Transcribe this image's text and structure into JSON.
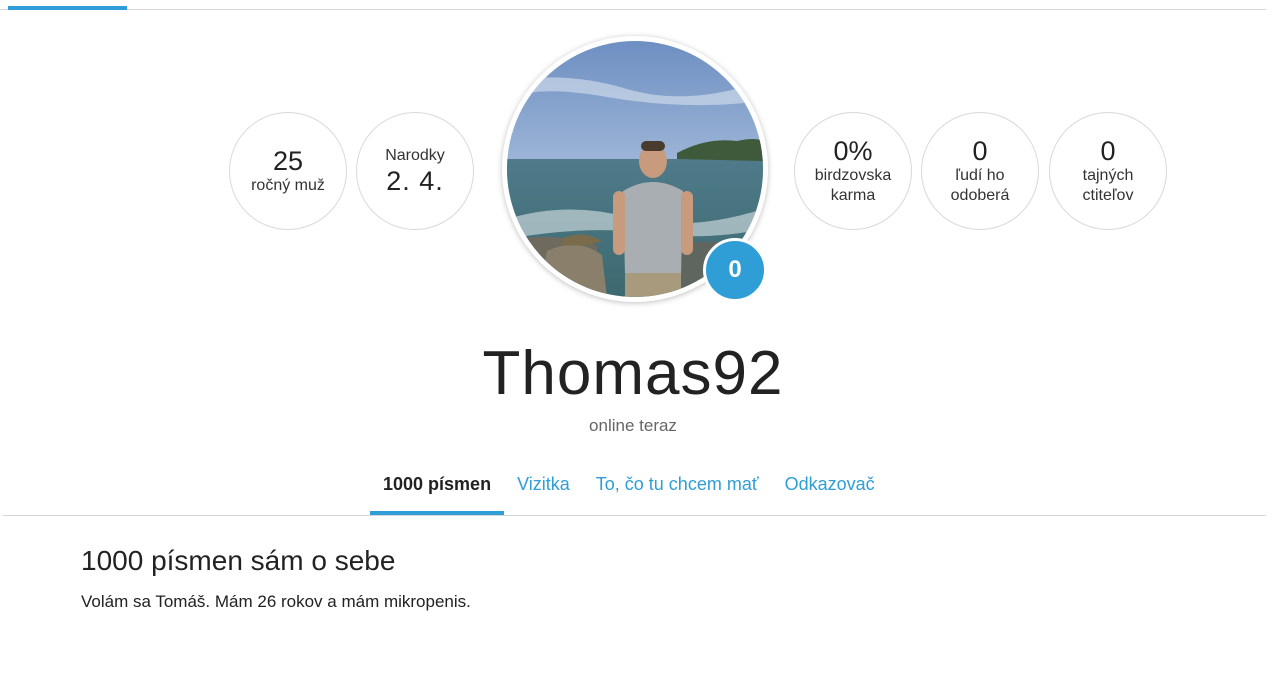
{
  "stats_left": [
    {
      "top": "25",
      "bottom": "ročný muž"
    },
    {
      "top": "Narodky",
      "bottom": "2. 4."
    }
  ],
  "stats_right": [
    {
      "top": "0%",
      "bottom": "birdzovska karma"
    },
    {
      "top": "0",
      "bottom": "ľudí ho odoberá"
    },
    {
      "top": "0",
      "bottom": "tajných ctiteľov"
    }
  ],
  "badge_count": "0",
  "username": "Thomas92",
  "status": "online teraz",
  "tabs": [
    {
      "label": "1000 písmen",
      "active": true
    },
    {
      "label": "Vizitka",
      "active": false
    },
    {
      "label": "To, čo tu chcem mať",
      "active": false
    },
    {
      "label": "Odkazovač",
      "active": false
    }
  ],
  "section": {
    "title": "1000 písmen sám o sebe",
    "text": "Volám sa Tomáš. Mám 26 rokov a mám mikropenis."
  },
  "colors": {
    "accent": "#2f9ed6",
    "border": "#d9d9d9"
  }
}
